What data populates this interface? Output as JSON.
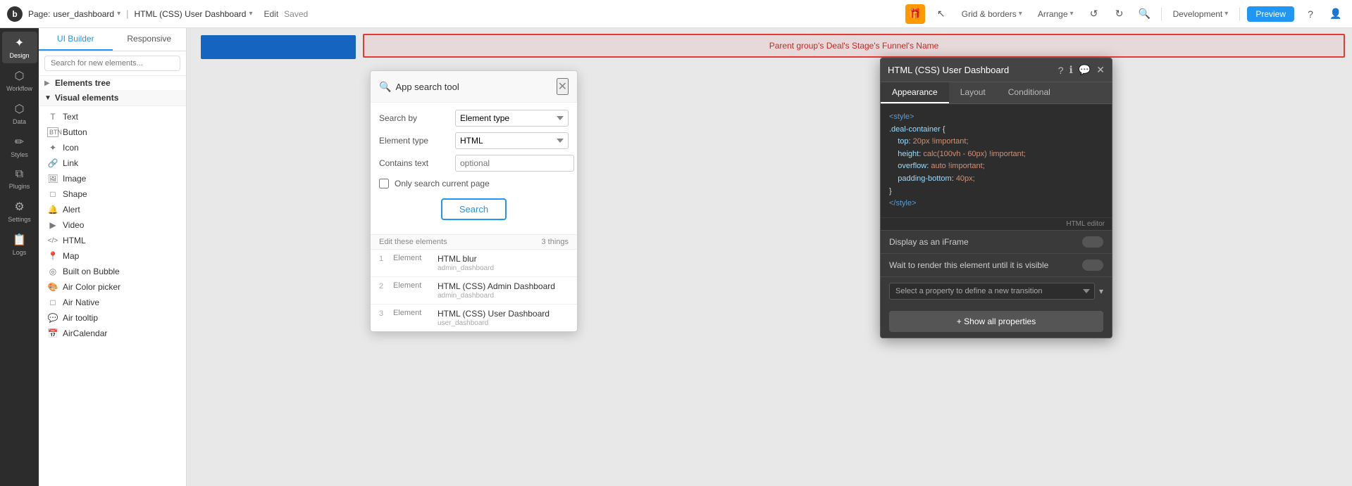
{
  "topbar": {
    "logo": "b",
    "page_label": "Page:",
    "page_name": "user_dashboard",
    "chevron": "▾",
    "html_name": "HTML (CSS) User Dashboard",
    "html_chevron": "▾",
    "edit_label": "Edit",
    "saved_label": "Saved",
    "grid_borders": "Grid & borders",
    "arrange": "Arrange",
    "undo_icon": "↺",
    "redo_icon": "↻",
    "search_icon": "🔍",
    "development": "Development",
    "preview": "Preview",
    "help_icon": "?",
    "user_icon": "👤",
    "gift_icon": "🎁"
  },
  "sidebar": {
    "items": [
      {
        "icon": "✦",
        "label": "Design",
        "active": true
      },
      {
        "icon": "◈",
        "label": "Workflow"
      },
      {
        "icon": "⬡",
        "label": "Data"
      },
      {
        "icon": "✏",
        "label": "Styles"
      },
      {
        "icon": "⧉",
        "label": "Plugins"
      },
      {
        "icon": "⚙",
        "label": "Settings"
      },
      {
        "icon": "📋",
        "label": "Logs"
      }
    ]
  },
  "elements_panel": {
    "tab_ui": "UI Builder",
    "tab_responsive": "Responsive",
    "search_placeholder": "Search for new elements...",
    "tree_section": "Elements tree",
    "visual_elements_label": "Visual elements",
    "elements": [
      {
        "icon": "T",
        "label": "Text"
      },
      {
        "icon": "▣",
        "label": "Button"
      },
      {
        "icon": "✦",
        "label": "Icon"
      },
      {
        "icon": "🔗",
        "label": "Link"
      },
      {
        "icon": "🖼",
        "label": "Image"
      },
      {
        "icon": "□",
        "label": "Shape"
      },
      {
        "icon": "🔔",
        "label": "Alert"
      },
      {
        "icon": "▶",
        "label": "Video"
      },
      {
        "icon": "</>",
        "label": "HTML"
      },
      {
        "icon": "📍",
        "label": "Map"
      },
      {
        "icon": "◎",
        "label": "Built on Bubble"
      },
      {
        "icon": "🎨",
        "label": "Air Color picker"
      },
      {
        "icon": "□",
        "label": "Air Native"
      },
      {
        "icon": "💬",
        "label": "Air tooltip"
      },
      {
        "icon": "📅",
        "label": "AirCalendar"
      }
    ]
  },
  "search_modal": {
    "title": "App search tool",
    "close_icon": "✕",
    "search_by_label": "Search by",
    "search_by_value": "Element type",
    "element_type_label": "Element type",
    "element_type_value": "HTML",
    "contains_text_label": "Contains text",
    "contains_text_placeholder": "optional",
    "only_current_page_label": "Only search current page",
    "search_button": "Search",
    "edit_label": "Edit these elements",
    "results_count": "3 things",
    "results": [
      {
        "num": "1",
        "type": "Element",
        "name": "HTML blur",
        "page": "admin_dashboard"
      },
      {
        "num": "2",
        "type": "Element",
        "name": "HTML (CSS) Admin Dashboard",
        "page": "admin_dashboard"
      },
      {
        "num": "3",
        "type": "Element",
        "name": "HTML (CSS) User Dashboard",
        "page": "user_dashboard"
      }
    ]
  },
  "html_panel": {
    "title": "HTML (CSS) User Dashboard",
    "help_icon": "?",
    "info_icon": "ℹ",
    "chat_icon": "💬",
    "close_icon": "✕",
    "tabs": [
      {
        "label": "Appearance",
        "active": true
      },
      {
        "label": "Layout",
        "active": false
      },
      {
        "label": "Conditional",
        "active": false
      }
    ],
    "code": [
      "<style>",
      ".deal-container {",
      "    top: 20px !important;",
      "    height: calc(100vh - 60px) !important;",
      "    overflow: auto !important;",
      "    padding-bottom: 40px;",
      "}",
      "</style>"
    ],
    "html_editor_label": "HTML editor",
    "display_iframe_label": "Display as an iFrame",
    "wait_render_label": "Wait to render this element until it is visible",
    "transition_placeholder": "Select a property to define a new transition",
    "show_all_label": "+ Show all properties"
  },
  "canvas": {
    "red_text": "Parent group's Deal's Stage's Funnel's Name"
  }
}
